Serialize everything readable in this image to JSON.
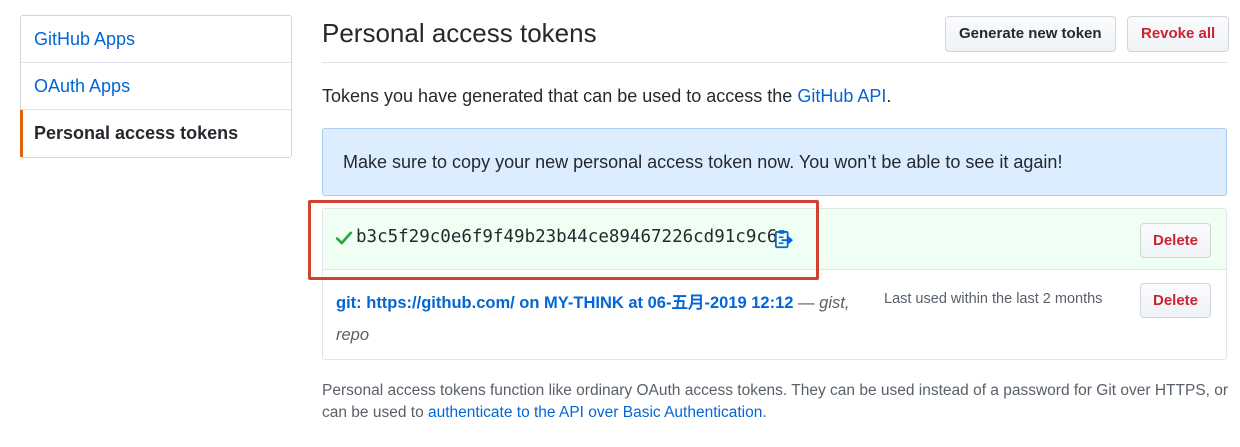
{
  "sidebar": {
    "items": [
      {
        "label": "GitHub Apps"
      },
      {
        "label": "OAuth Apps"
      },
      {
        "label": "Personal access tokens"
      }
    ]
  },
  "header": {
    "title": "Personal access tokens",
    "generate_label": "Generate new token",
    "revoke_label": "Revoke all"
  },
  "intro": {
    "text": "Tokens you have generated that can be used to access the ",
    "link": "GitHub API",
    "end": "."
  },
  "flash": {
    "message": "Make sure to copy your new personal access token now. You won’t be able to see it again!"
  },
  "tokens": {
    "new_token": {
      "value": "b3c5f29c0e6f9f49b23b44ce89467226cd91c9c6",
      "delete_label": "Delete",
      "check_icon": "check-icon",
      "copy_icon": "clipboard-icon"
    },
    "existing": {
      "name": "git: https://github.com/ on MY-THINK at 06-五月-2019 12:12",
      "separator": " — ",
      "scopes": "gist, repo",
      "last_used": "Last used within the last 2 months",
      "delete_label": "Delete"
    }
  },
  "footnote": {
    "text": "Personal access tokens function like ordinary OAuth access tokens. They can be used instead of a password for Git over HTTPS, or can be used to ",
    "link": "authenticate to the API over Basic Authentication",
    "end": "."
  },
  "colors": {
    "link": "#0366d6",
    "danger": "#cb2431",
    "selected_accent": "#e36209",
    "flash_bg": "#dbedff",
    "new_token_bg": "#f0fff4",
    "highlight": "#d2412f",
    "check": "#28a745"
  }
}
